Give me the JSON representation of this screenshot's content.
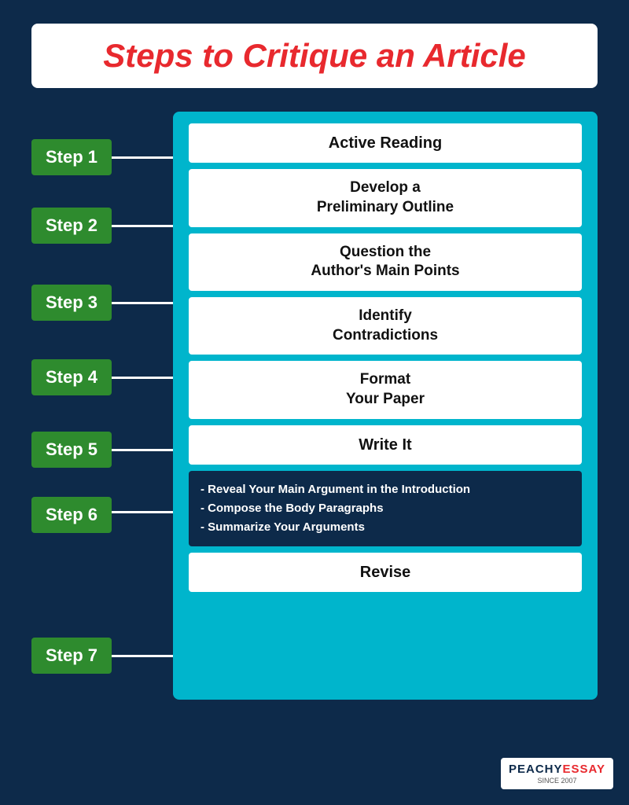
{
  "title": "Steps to Critique an Article",
  "steps": [
    {
      "label": "Step 1",
      "id": "step1"
    },
    {
      "label": "Step 2",
      "id": "step2"
    },
    {
      "label": "Step 3",
      "id": "step3"
    },
    {
      "label": "Step 4",
      "id": "step4"
    },
    {
      "label": "Step 5",
      "id": "step5"
    },
    {
      "label": "Step 6",
      "id": "step6"
    },
    {
      "label": "Step 7",
      "id": "step7"
    }
  ],
  "cards": [
    {
      "id": "card1",
      "text": "Active Reading",
      "dark": false
    },
    {
      "id": "card2",
      "text": "Develop a\nPreliminary Outline",
      "dark": false
    },
    {
      "id": "card3",
      "text": "Question the\nAuthor's Main Points",
      "dark": false
    },
    {
      "id": "card4",
      "text": "Identify\nContradictions",
      "dark": false
    },
    {
      "id": "card5",
      "text": "Format\nYour Paper",
      "dark": false
    },
    {
      "id": "card6",
      "text": "Write It",
      "dark": false
    },
    {
      "id": "card6sub",
      "bullets": [
        "- Reveal Your Main Argument in the Introduction",
        "- Compose the Body Paragraphs",
        "- Summarize Your Arguments"
      ],
      "dark": true
    },
    {
      "id": "card7",
      "text": "Revise",
      "dark": false
    }
  ],
  "logo": {
    "peachy": "PEACHY",
    "essay": "ESSAY",
    "since": "SINCE 2007"
  }
}
